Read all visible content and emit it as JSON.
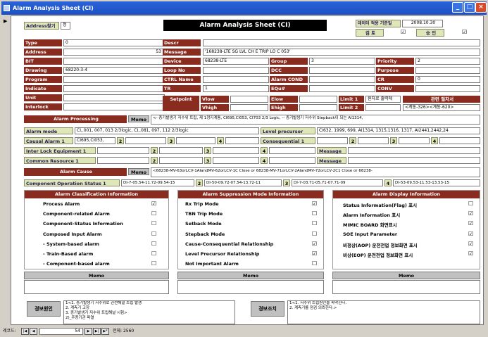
{
  "window": {
    "title": "Alarm Analysis Sheet (CI)",
    "min": "_",
    "max": "□",
    "close": "×"
  },
  "header": {
    "search_label": "Address찾기",
    "search_value": "정",
    "title": "Alarm Analysis Sheet (CI)",
    "data_date_label": "데이터 적용 기준일",
    "data_date": "2008.10.30",
    "review_label": "검 토",
    "approve_label": "승 인",
    "review_checked": "☑",
    "approve_checked": "☑"
  },
  "fields": {
    "type": {
      "label": "Type",
      "value": "0"
    },
    "address": {
      "label": "Address",
      "value": "53"
    },
    "bit": {
      "label": "BIT",
      "value": ""
    },
    "drawing": {
      "label": "Drawing",
      "value": "68220-3-4"
    },
    "program": {
      "label": "Program",
      "value": ""
    },
    "indicate": {
      "label": "Indicate",
      "value": ""
    },
    "unit": {
      "label": "Unit",
      "value": ""
    },
    "interlock": {
      "label": "Interlock",
      "value": ""
    },
    "descr": {
      "label": "Descr",
      "value": ""
    },
    "message": {
      "label": "Message",
      "value": "'168238-LTE SG LVL CH E TRIP LO      C 053'"
    },
    "device": {
      "label": "Device",
      "value": "68238-LTE"
    },
    "loopno": {
      "label": "Loop No",
      "value": ""
    },
    "ctrlname": {
      "label": "CTRL Name",
      "value": ""
    },
    "tr": {
      "label": "TR",
      "value": "1"
    },
    "group": {
      "label": "Group",
      "value": "3"
    },
    "dcc": {
      "label": "DCC",
      "value": ""
    },
    "alarmcond": {
      "label": "Alarm COND",
      "value": ""
    },
    "equ": {
      "label": "EQu#",
      "value": ""
    },
    "priority": {
      "label": "Priority",
      "value": "2"
    },
    "purpose": {
      "label": "Purpose",
      "value": ""
    },
    "cr": {
      "label": "CR",
      "value": "0"
    },
    "conv": {
      "label": "CONV",
      "value": ""
    },
    "setpoint": {
      "label": "Setpoint",
      "vlow": "Vlow",
      "vhigh": "Vhigh",
      "elow": "Elow",
      "ehigh": "Ehigh",
      "limit1": "Limit 1",
      "limit2": "Limit 2",
      "limit1_value": "원자로 출력에",
      "related_label": "관련 절차서",
      "related_value": "<계통-326><계통-620>"
    }
  },
  "processing": {
    "header": "Alarm Processing",
    "memo_label": "Memo",
    "memo_text": "<- 증기발생기 저수위 트립, 제 1정지계통, CI695,CI053, CI703 2/3 Logic, -- 증기발생기 저수위 Stepback이 되는 AI1314,",
    "alarm_mode_label": "Alarm mode",
    "alarm_mode": "CI,.001, 007, 013 2/3logic, CI,.081, 097, 112 2/3logic",
    "level_precursor_label": "Level precursor",
    "level_precursor": "CI632, 1999, 699, AI1314, 1315,1316, 1317, AI2441,2442,24",
    "causal_label": "Causal Alarm 1",
    "causal_value": "CI695,CI053,",
    "consequential_label": "Consequential 1",
    "interlock_label": "Inter Lock Equipment 1",
    "common_label": "Common Resource 1",
    "message_label": "Message",
    "n2": "2",
    "n3": "3",
    "n4": "4"
  },
  "cause": {
    "header": "Alarm Cause",
    "memo_label": "Memo",
    "memo_text": "<68238-MV-63orLCV-1AIandMV-62orLCV-1C Close or 68238-MV-71orLCV-2AIandMV-72orLCV-2C1 Close or 68238-",
    "cos_label": "Component Operation Status 1",
    "cos1": "DI-7-05.54-11.72-09.54-15",
    "cos2": "DI-50-09.72-07.54-13.72-11",
    "cos3": "DI-7-03.71-05.71-07.71-09",
    "cos4": "DI-53-09.53-11.53-13.53-15"
  },
  "classification": {
    "header": "Alarm Classification Information",
    "items": [
      {
        "label": "Process Alarm",
        "mark": "☑"
      },
      {
        "label": "Component-related Alarm",
        "mark": "☐"
      },
      {
        "label": "Component-Status Information",
        "mark": "☐"
      },
      {
        "label": "Composed Input Alarm",
        "mark": "☐"
      },
      {
        "label": "- System-based alarm",
        "mark": "☐"
      },
      {
        "label": "- Train-Based alarm",
        "mark": "☐"
      },
      {
        "label": "- Component-based alarm",
        "mark": "☐"
      }
    ]
  },
  "suppression": {
    "header": "Alarm Suppression Mode Information",
    "items": [
      {
        "label": "Rx Trip Mode",
        "mark": "☑"
      },
      {
        "label": "TBN Trip Mode",
        "mark": "☐"
      },
      {
        "label": "Setback Mode",
        "mark": "☐"
      },
      {
        "label": "Stepback Mode",
        "mark": "☐"
      },
      {
        "label": "Cause-Consequential Relationship",
        "mark": "☑"
      },
      {
        "label": "Level Precursor Relationship",
        "mark": "☑"
      },
      {
        "label": "Not Important Alarm",
        "mark": "☐"
      }
    ]
  },
  "display": {
    "header": "Alarm Display Information",
    "items": [
      {
        "label": "Status Information(Flag) 표시",
        "mark": "☐"
      },
      {
        "label": "Alarm Information 표시",
        "mark": "☑"
      },
      {
        "label": "MIMIC BOARD 화면표시",
        "mark": "☑"
      },
      {
        "label": "SOE Input Parameter",
        "mark": "☑"
      },
      {
        "label": "비정상(AOP) 운전전업 정보화면 표시",
        "mark": "☑"
      },
      {
        "label": "비상(EOP) 운전전업 정보화면 표시",
        "mark": "☑"
      }
    ]
  },
  "memo": {
    "label": "Memo"
  },
  "alarm_reason": {
    "label": "경보원인",
    "lines": [
      "1<1. 증기발생기 저수위로 관련해널 트립 발생",
      "2. 계측기 고장",
      "3. 증기발생기 저수위 트립해널 시험>",
      "2)_주증기관 파열"
    ]
  },
  "alarm_action": {
    "label": "경보조치",
    "lines": [
      "1<1. 저수위 트립원인을 파악한다.",
      "2. 계측기를 점검 의뢰한다.>"
    ]
  },
  "nav": {
    "record_label": "레코드:",
    "current": "54",
    "total_label": "전체: 2560",
    "first": "|◀",
    "prev": "◀",
    "next": "▶",
    "last": "▶|",
    "new": "▶*"
  }
}
